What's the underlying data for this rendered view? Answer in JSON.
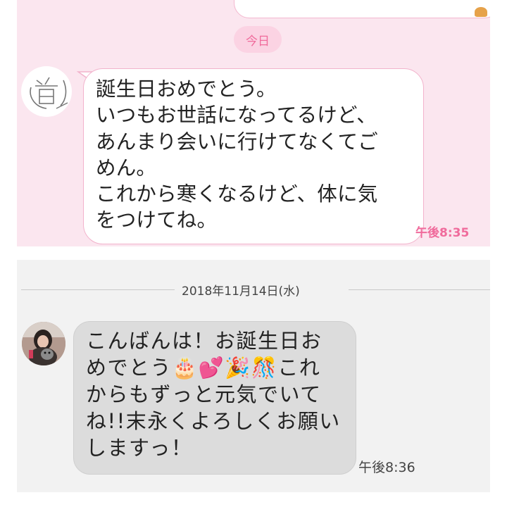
{
  "top_chat": {
    "day_label": "今日",
    "message": "誕生日おめでとう。\nいつもお世話になってるけど、\nあんまり会いに行けてなくてご\nめん。\nこれから寒くなるけど、体に気\nをつけてね。",
    "time": "午後8:35",
    "colors": {
      "background": "#fbe6ef",
      "accent": "#f06b9c",
      "bubble_border": "#f2b3cc"
    }
  },
  "bottom_chat": {
    "date_separator": "2018年11月14日(水)",
    "message": "こんばんは！お誕生日お\nめでとう🎂💕🎉🎊これ\nからもずっと元気でいて\nね!!末永くよろしくお願い\nしますっ！",
    "time": "午後8:36",
    "colors": {
      "background": "#f2f2f2",
      "bubble": "#dcdcdc"
    }
  }
}
